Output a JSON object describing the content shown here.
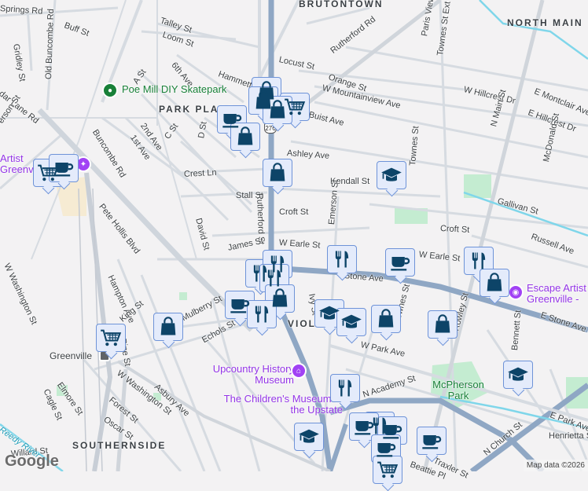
{
  "neighborhoods": [
    "BRUTONTOWN",
    "NORTH MAIN",
    "PARK PLACE",
    "VIOLA",
    "SOUTHERNSIDE"
  ],
  "streets": [
    "Springs Rd",
    "Buff St",
    "Old Buncombe Rd",
    "Gridley St",
    "Talley St",
    "Loom St",
    "6th Ave",
    "A St",
    "Hammett St",
    "Locust St",
    "Rutherford Rd",
    "Orange St",
    "W Mountainview Ave",
    "Buist Ave",
    "Ashley Ave",
    "dar Lane Rd",
    "erson St",
    "Buncombe Rd",
    "2nd Ave",
    "1st Ave",
    "C St",
    "D St",
    "Crest Ln",
    "Stall St",
    "Croft St",
    "Pete Hollis Blvd",
    "David St",
    "Rutherford St",
    "W Earle St",
    "James St",
    "Hampton Ave",
    "W Washington St",
    "King St",
    "Pine St",
    "Mulberry St",
    "Echols St",
    "Asbury Ave",
    "W Washington St",
    "Elmore St",
    "Cagle St",
    "Forest St",
    "Oscar St",
    "Willard St",
    "Paris View Dr",
    "Townes St Ext",
    "W Hillcrest Dr",
    "E Montclair Ave",
    "E Hillcrest Dr",
    "N Main St",
    "McDonald St",
    "Townes St",
    "Gallivan St",
    "Croft St",
    "Russell Ave",
    "W Earle St",
    "Stone Ave",
    "E Stone Ave",
    "Ivy St",
    "Townes St",
    "Rowley St",
    "Bennett St",
    "W Park Ave",
    "N Academy St",
    "E Park Ave",
    "N Church St",
    "Henrietta St",
    "Kendall St",
    "Emerson St",
    "Beattie Pl",
    "Traxler St"
  ],
  "water": [
    "Reedy River"
  ],
  "pois": {
    "skatepark": "Poe Mill DIY Skatepark",
    "artist": "Artist Greenville - Hampton St",
    "upcountry": "Upcountry History Museum",
    "childrens": "The Children's Museum of the Upstate",
    "escape": "Escape Artist Greenville - D",
    "mcpherson": "McPherson Park",
    "greenville": "Greenville"
  },
  "markers": [
    "shopping-bag",
    "shopping-bag",
    "grocery-cart",
    "shopping-bag",
    "coffee-cup",
    "shopping-bag",
    "shopping-bag",
    "grocery-cart",
    "coffee-cup",
    "school",
    "restaurant",
    "restaurant",
    "restaurant",
    "coffee-cup",
    "shopping-bag",
    "restaurant",
    "restaurant",
    "coffee-cup",
    "restaurant",
    "shopping-bag",
    "school",
    "school",
    "shopping-bag",
    "shopping-bag",
    "shopping-bag",
    "grocery-cart",
    "school",
    "restaurant",
    "school",
    "coffee-cup",
    "restaurant",
    "coffee-cup",
    "coffee-cup",
    "coffee-cup",
    "grocery-cart"
  ],
  "route_shield": "276",
  "attribution": {
    "logo": "Google",
    "map_data": "Map data ©2026"
  },
  "colors": {
    "marker_icon": "#0d4468",
    "marker_bg": "#e4ebfb",
    "arterial": "#8fa7c4",
    "road": "#d6dbe1"
  }
}
